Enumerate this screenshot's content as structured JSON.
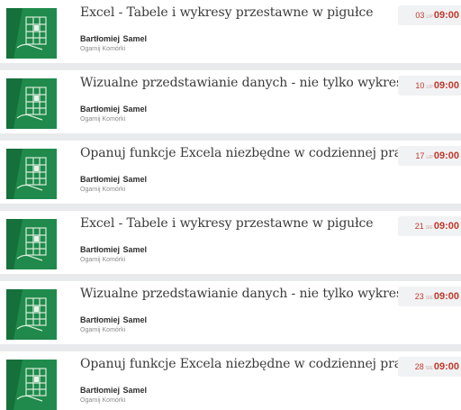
{
  "events": [
    {
      "title": "Excel - Tabele i wykresy przestawne w pigułce",
      "author": "Bartłomiej  Samel",
      "organization": "Ogarnij Komórki",
      "day": "03",
      "month": "LIP",
      "time": "09:00",
      "thumbnail_icon": "spreadsheet-hand-icon"
    },
    {
      "title": "Wizualne przedstawianie danych - nie tylko wykresy",
      "author": "Bartłomiej  Samel",
      "organization": "Ogarnij Komórki",
      "day": "10",
      "month": "LIP",
      "time": "09:00",
      "thumbnail_icon": "spreadsheet-hand-icon"
    },
    {
      "title": "Opanuj funkcje Excela niezbędne w codziennej pracy",
      "author": "Bartłomiej  Samel",
      "organization": "Ogarnij Komórki",
      "day": "17",
      "month": "LIP",
      "time": "09:00",
      "thumbnail_icon": "spreadsheet-hand-icon"
    },
    {
      "title": "Excel - Tabele i wykresy przestawne w pigułce",
      "author": "Bartłomiej  Samel",
      "organization": "Ogarnij Komórki",
      "day": "21",
      "month": "SIE",
      "time": "09:00",
      "thumbnail_icon": "spreadsheet-hand-icon"
    },
    {
      "title": "Wizualne przedstawianie danych - nie tylko wykresy",
      "author": "Bartłomiej  Samel",
      "organization": "Ogarnij Komórki",
      "day": "23",
      "month": "SIE",
      "time": "09:00",
      "thumbnail_icon": "spreadsheet-hand-icon"
    },
    {
      "title": "Opanuj funkcje Excela niezbędne w codziennej pracy",
      "author": "Bartłomiej  Samel",
      "organization": "Ogarnij Komórki",
      "day": "28",
      "month": "SIE",
      "time": "09:00",
      "thumbnail_icon": "spreadsheet-hand-icon"
    }
  ],
  "colors": {
    "accent_red": "#c0392b",
    "thumbnail_green": "#1f8a4c",
    "separator": "#e9eaec"
  }
}
